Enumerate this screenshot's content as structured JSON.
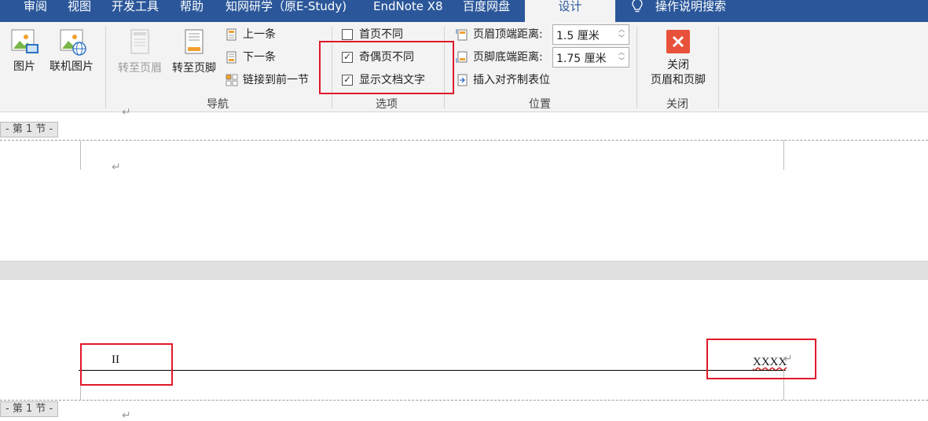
{
  "tabs": [
    {
      "label": "审阅",
      "active": false
    },
    {
      "label": "视图",
      "active": false
    },
    {
      "label": "开发工具",
      "active": false
    },
    {
      "label": "帮助",
      "active": false
    },
    {
      "label": "知网研学（原E-Study)",
      "active": false
    },
    {
      "label": "EndNote X8",
      "active": false
    },
    {
      "label": "百度网盘",
      "active": false
    },
    {
      "label": "设计",
      "active": true
    }
  ],
  "tell_me": {
    "label": "操作说明搜索",
    "icon": "lightbulb-icon"
  },
  "insert_group": {
    "picture_label": "图片",
    "online_picture_label": "联机图片"
  },
  "navigation_group": {
    "label": "导航",
    "goto_header_label": "转至页眉",
    "goto_footer_label": "转至页脚",
    "previous_label": "上一条",
    "next_label": "下一条",
    "link_previous_label": "链接到前一节"
  },
  "options_group": {
    "label": "选项",
    "different_first_page": {
      "label": "首页不同",
      "checked": false
    },
    "different_odd_even": {
      "label": "奇偶页不同",
      "checked": true
    },
    "show_document_text": {
      "label": "显示文档文字",
      "checked": true
    }
  },
  "position_group": {
    "label": "位置",
    "header_from_top_label": "页眉顶端距离:",
    "header_from_top_value": "1.5 厘米",
    "footer_from_bottom_label": "页脚底端距离:",
    "footer_from_bottom_value": "1.75 厘米",
    "insert_alignment_tab_label": "插入对齐制表位"
  },
  "close_group": {
    "label": "关闭",
    "close_line1": "关闭",
    "close_line2": "页眉和页脚"
  },
  "document": {
    "section_label_top": "- 第 1 节 -",
    "section_label_bottom": "- 第 1 节 -",
    "paragraph_mark": "↵",
    "header_left_text": "II",
    "header_right_text": "XXXX"
  },
  "colors": {
    "tab_bar": "#2b579a",
    "ribbon": "#f3f3f3",
    "highlight_box": "#e0182a",
    "close_icon": "#e8513a"
  }
}
